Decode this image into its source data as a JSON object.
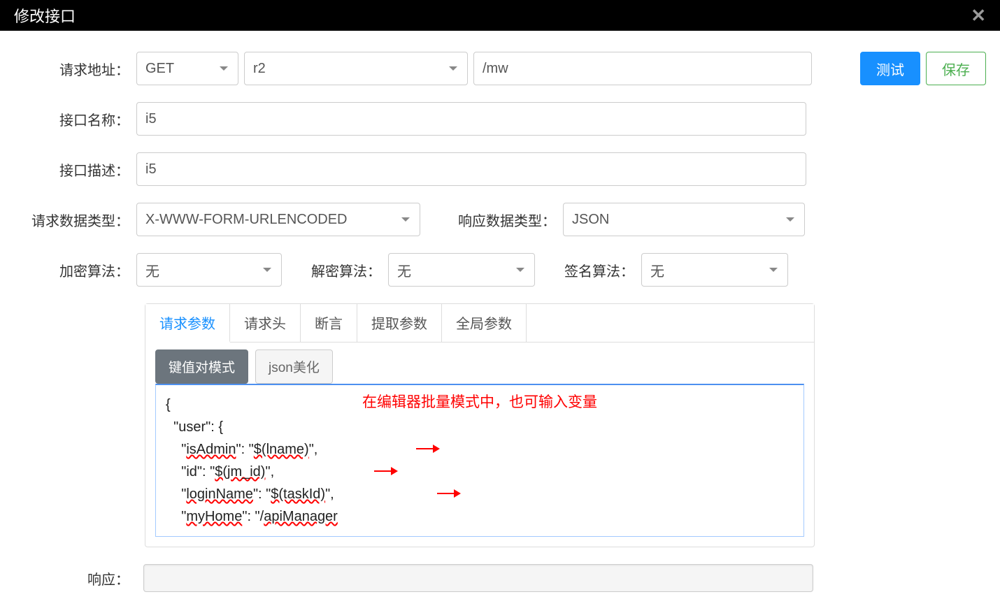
{
  "modal": {
    "title": "修改接口"
  },
  "labels": {
    "request_url": "请求地址：",
    "interface_name": "接口名称：",
    "interface_desc": "接口描述：",
    "request_data_type": "请求数据类型：",
    "response_data_type": "响应数据类型：",
    "encrypt_algo": "加密算法：",
    "decrypt_algo": "解密算法：",
    "sign_algo": "签名算法：",
    "response": "响应："
  },
  "values": {
    "method": "GET",
    "module": "r2",
    "path": "/mw",
    "name": "i5",
    "description": "i5",
    "request_type": "X-WWW-FORM-URLENCODED",
    "response_type": "JSON",
    "encrypt": "无",
    "decrypt": "无",
    "sign": "无"
  },
  "buttons": {
    "test": "测试",
    "save": "保存",
    "kv_mode": "键值对模式",
    "json_beautify": "json美化"
  },
  "tabs": {
    "request_params": "请求参数",
    "headers": "请求头",
    "assertions": "断言",
    "extract_params": "提取参数",
    "global_params": "全局参数"
  },
  "editor": {
    "annotation": "在编辑器批量模式中，也可输入变量",
    "code": {
      "l1": "{",
      "l2_pre": "  \"user\": {",
      "l3_pre": "    \"",
      "l3_k": "isAdmin",
      "l3_mid": "\": \"",
      "l3_v": "$(lname)",
      "l3_end": "\",",
      "l4_pre": "    \"id\": \"",
      "l4_v": "$(jm_id)",
      "l4_end": "\",",
      "l5_pre": "    \"",
      "l5_k": "loginName",
      "l5_mid": "\": \"",
      "l5_v": "$(taskId)",
      "l5_end": "\",",
      "l6_pre": "    \"",
      "l6_k": "myHome",
      "l6_mid": "\": \"/",
      "l6_v": "apiManager"
    }
  }
}
